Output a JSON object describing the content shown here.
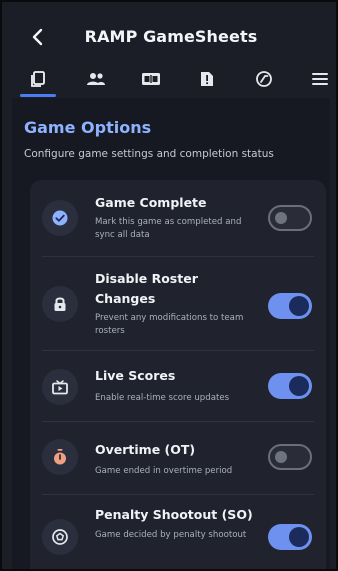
{
  "header": {
    "title": "RAMP GameSheets",
    "back_icon": "chevron-left-icon"
  },
  "tabs": [
    {
      "icon": "copy-icon",
      "active": true
    },
    {
      "icon": "people-icon",
      "active": false
    },
    {
      "icon": "scoreboard-icon",
      "active": false
    },
    {
      "icon": "alert-doc-icon",
      "active": false
    },
    {
      "icon": "whistle-icon",
      "active": false
    },
    {
      "icon": "menu-icon",
      "active": false
    }
  ],
  "section": {
    "title": "Game Options",
    "description": "Configure game settings and completion status"
  },
  "options": [
    {
      "title": "Game Complete",
      "description": "Mark this game as completed and sync all data",
      "icon": "check-circle-icon",
      "enabled": false
    },
    {
      "title": "Disable Roster Changes",
      "description": "Prevent any modifications to team rosters",
      "icon": "lock-icon",
      "enabled": true
    },
    {
      "title": "Live Scores",
      "description": "Enable real-time score updates",
      "icon": "live-tv-icon",
      "enabled": true
    },
    {
      "title": "Overtime (OT)",
      "description": "Game ended in overtime period",
      "icon": "stopwatch-icon",
      "enabled": false
    },
    {
      "title": "Penalty Shootout (SO)",
      "description": "Game decided by penalty shootout",
      "icon": "target-icon",
      "enabled": true
    }
  ],
  "colors": {
    "accent": "#8fb2ff",
    "toggle_on": "#6e90ef",
    "timer_icon": "#f0a080"
  }
}
